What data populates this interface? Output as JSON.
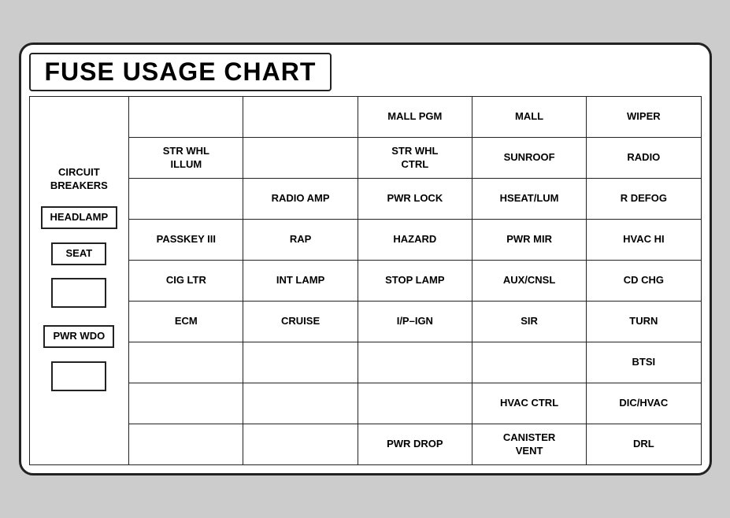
{
  "title": "FUSE USAGE CHART",
  "columns": {
    "cb": "CIRCUIT BREAKERS",
    "c2": "",
    "c3": "",
    "c4": "",
    "c5": "",
    "c6": ""
  },
  "cb_items": [
    {
      "label": "HEADLAMP",
      "has_box": true
    },
    {
      "label": "SEAT",
      "has_box": true
    },
    {
      "label": "",
      "has_box": true,
      "empty": true
    },
    {
      "label": "PWR WDO",
      "has_box": true
    },
    {
      "label": "",
      "has_box": true,
      "empty": true
    }
  ],
  "rows": [
    [
      "",
      "",
      "MALL PGM",
      "MALL",
      "WIPER"
    ],
    [
      "STR WHL\nILLUM",
      "",
      "STR WHL\nCTRL",
      "SUNROOF",
      "RADIO"
    ],
    [
      "",
      "RADIO AMP",
      "PWR LOCK",
      "HSEAT/LUM",
      "R DEFOG"
    ],
    [
      "PASSKEY III",
      "RAP",
      "HAZARD",
      "PWR MIR",
      "HVAC HI"
    ],
    [
      "CIG LTR",
      "INT LAMP",
      "STOP LAMP",
      "AUX/CNSL",
      "CD CHG"
    ],
    [
      "ECM",
      "CRUISE",
      "I/P-IGN",
      "SIR",
      "TURN"
    ],
    [
      "",
      "",
      "",
      "",
      "BTSI"
    ],
    [
      "",
      "",
      "",
      "HVAC CTRL",
      "DIC/HVAC"
    ],
    [
      "",
      "",
      "PWR DROP",
      "CANISTER\nVENT",
      "DRL"
    ]
  ]
}
